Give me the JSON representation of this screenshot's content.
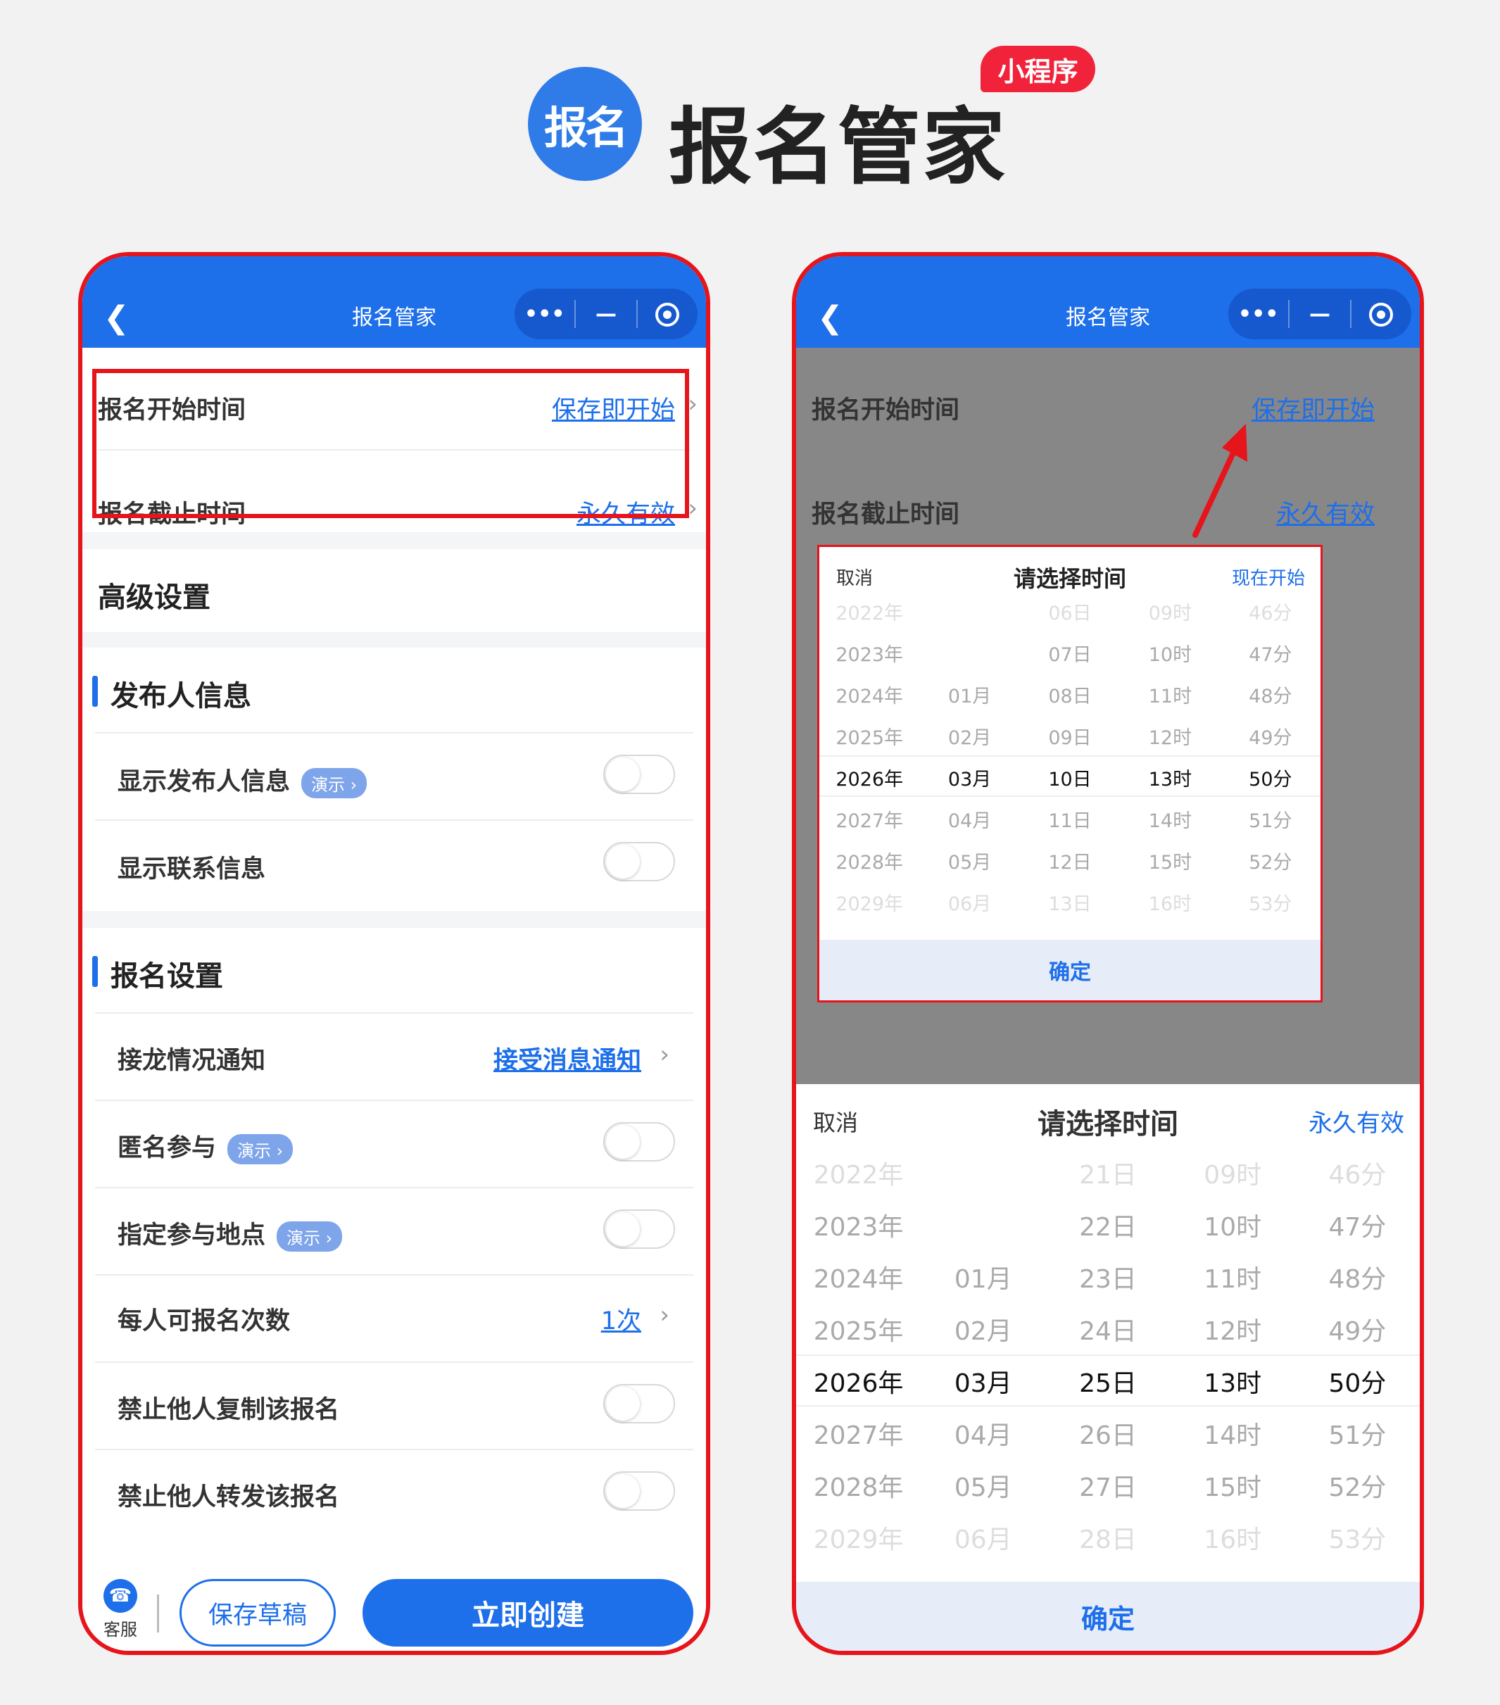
{
  "brand": {
    "logo_text": "报名",
    "title": "报名管家",
    "tag": "小程序"
  },
  "nav": {
    "back_icon": "chevron-left-icon",
    "title": "报名管家",
    "capsule_more": "•••",
    "capsule_minimize": "—"
  },
  "left": {
    "time_rows": [
      {
        "label": "报名开始时间",
        "value": "保存即开始"
      },
      {
        "label": "报名截止时间",
        "value": "永久有效"
      }
    ],
    "advanced_title": "高级设置",
    "publisher_section": {
      "title": "发布人信息",
      "rows": [
        {
          "label": "显示发布人信息",
          "demo": "演示 ›"
        },
        {
          "label": "显示联系信息"
        }
      ]
    },
    "signup_section": {
      "title": "报名设置",
      "rows": [
        {
          "label": "接龙情况通知",
          "value": "接受消息通知"
        },
        {
          "label": "匿名参与",
          "demo": "演示 ›"
        },
        {
          "label": "指定参与地点",
          "demo": "演示 ›"
        },
        {
          "label": "每人可报名次数",
          "value": "1次"
        },
        {
          "label": "禁止他人复制该报名"
        },
        {
          "label": "禁止他人转发该报名"
        }
      ]
    },
    "bottom": {
      "service_label": "客服",
      "draft_button": "保存草稿",
      "create_button": "立即创建"
    }
  },
  "right": {
    "bg_rows": [
      {
        "label": "报名开始时间",
        "value": "保存即开始"
      },
      {
        "label": "报名截止时间",
        "value": "永久有效"
      }
    ],
    "popup": {
      "cancel": "取消",
      "title": "请选择时间",
      "action": "现在开始",
      "rows": [
        [
          "2022年",
          "",
          "06日",
          "09时",
          "46分"
        ],
        [
          "2023年",
          "",
          "07日",
          "10时",
          "47分"
        ],
        [
          "2024年",
          "01月",
          "08日",
          "11时",
          "48分"
        ],
        [
          "2025年",
          "02月",
          "09日",
          "12时",
          "49分"
        ],
        [
          "2026年",
          "03月",
          "10日",
          "13时",
          "50分"
        ],
        [
          "2027年",
          "04月",
          "11日",
          "14时",
          "51分"
        ],
        [
          "2028年",
          "05月",
          "12日",
          "15时",
          "52分"
        ],
        [
          "2029年",
          "06月",
          "13日",
          "16时",
          "53分"
        ]
      ],
      "selected_index": 4,
      "confirm": "确定"
    },
    "sheet": {
      "cancel": "取消",
      "title": "请选择时间",
      "action": "永久有效",
      "rows": [
        [
          "2022年",
          "",
          "21日",
          "09时",
          "46分"
        ],
        [
          "2023年",
          "",
          "22日",
          "10时",
          "47分"
        ],
        [
          "2024年",
          "01月",
          "23日",
          "11时",
          "48分"
        ],
        [
          "2025年",
          "02月",
          "24日",
          "12时",
          "49分"
        ],
        [
          "2026年",
          "03月",
          "25日",
          "13时",
          "50分"
        ],
        [
          "2027年",
          "04月",
          "26日",
          "14时",
          "51分"
        ],
        [
          "2028年",
          "05月",
          "27日",
          "15时",
          "52分"
        ],
        [
          "2029年",
          "06月",
          "28日",
          "16时",
          "53分"
        ]
      ],
      "selected_index": 4,
      "confirm": "确定"
    }
  },
  "colors": {
    "primary": "#1e6fea",
    "highlight_red": "#e6141b",
    "tag_red": "#f0233b"
  }
}
